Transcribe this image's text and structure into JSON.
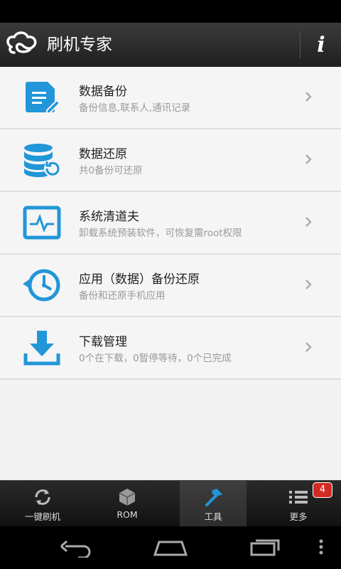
{
  "app": {
    "title": "刷机专家",
    "info_label": "i"
  },
  "menu": [
    {
      "icon": "document-edit-icon",
      "title": "数据备份",
      "subtitle": "备份信息,联系人,通讯记录"
    },
    {
      "icon": "database-restore-icon",
      "title": "数据还原",
      "subtitle": "共0备份可还原"
    },
    {
      "icon": "monitor-pulse-icon",
      "title": "系统清道夫",
      "subtitle": "卸载系统预装软件，可恢复需root权限"
    },
    {
      "icon": "clock-backup-icon",
      "title": "应用（数据）备份还原",
      "subtitle": "备份和还原手机应用"
    },
    {
      "icon": "download-icon",
      "title": "下载管理",
      "subtitle": "0个在下载，0暂停等待，0个已完成"
    }
  ],
  "tabs": [
    {
      "icon": "refresh-icon",
      "label": "一键刷机"
    },
    {
      "icon": "cube-icon",
      "label": "ROM"
    },
    {
      "icon": "hammer-icon",
      "label": "工具"
    },
    {
      "icon": "list-icon",
      "label": "更多",
      "badge": "4"
    }
  ],
  "active_tab": "工具",
  "colors": {
    "accent": "#2196d8",
    "background": "#f2f2f2",
    "appbar": "#2c2c2c",
    "badge": "#d32b24"
  }
}
